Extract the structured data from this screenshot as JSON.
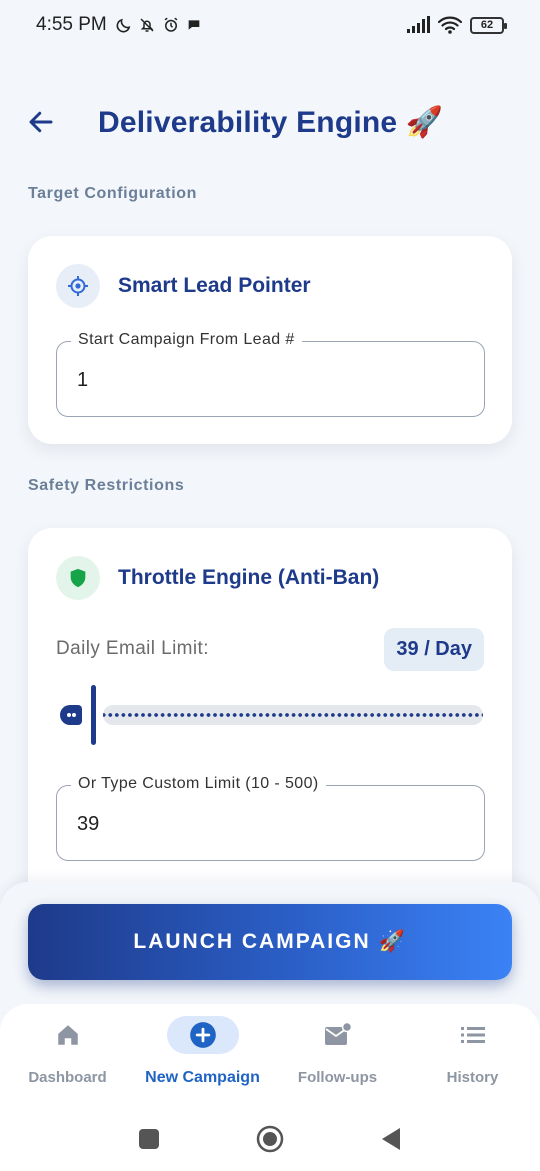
{
  "status_bar": {
    "time": "4:55 PM",
    "battery": "62",
    "icons": [
      "moon-icon",
      "bell-off-icon",
      "alarm-icon",
      "chat-bubble-icon",
      "signal-icon",
      "wifi-icon",
      "battery-icon"
    ]
  },
  "header": {
    "title": "Deliverability Engine 🚀",
    "back_icon": "arrow-left-icon"
  },
  "target_section": {
    "label": "Target Configuration",
    "card": {
      "icon": "crosshair-icon",
      "title": "Smart Lead Pointer",
      "field": {
        "label": "Start Campaign From Lead #",
        "value": "1"
      }
    }
  },
  "safety_section": {
    "label": "Safety Restrictions",
    "card": {
      "icon": "shield-icon",
      "title": "Throttle Engine (Anti-Ban)",
      "limit_label": "Daily Email Limit:",
      "limit_badge": "39 / Day",
      "slider": {
        "min": 10,
        "max": 500,
        "value": 39
      },
      "custom_field": {
        "label": "Or Type Custom Limit (10 - 500)",
        "value": "39"
      }
    }
  },
  "launch_button": {
    "label": "LAUNCH CAMPAIGN 🚀"
  },
  "bottom_nav": {
    "items": [
      {
        "label": "Dashboard",
        "icon": "home-icon",
        "active": false
      },
      {
        "label": "New Campaign",
        "icon": "add-circle-icon",
        "active": true
      },
      {
        "label": "Follow-ups",
        "icon": "mail-notification-icon",
        "active": false
      },
      {
        "label": "History",
        "icon": "list-icon",
        "active": false
      }
    ]
  },
  "colors": {
    "primary": "#1e3a8a",
    "accent": "#3b82f6",
    "background": "#f3f6fa",
    "section_label": "#6b7f99",
    "shield_green": "#16a34a"
  }
}
